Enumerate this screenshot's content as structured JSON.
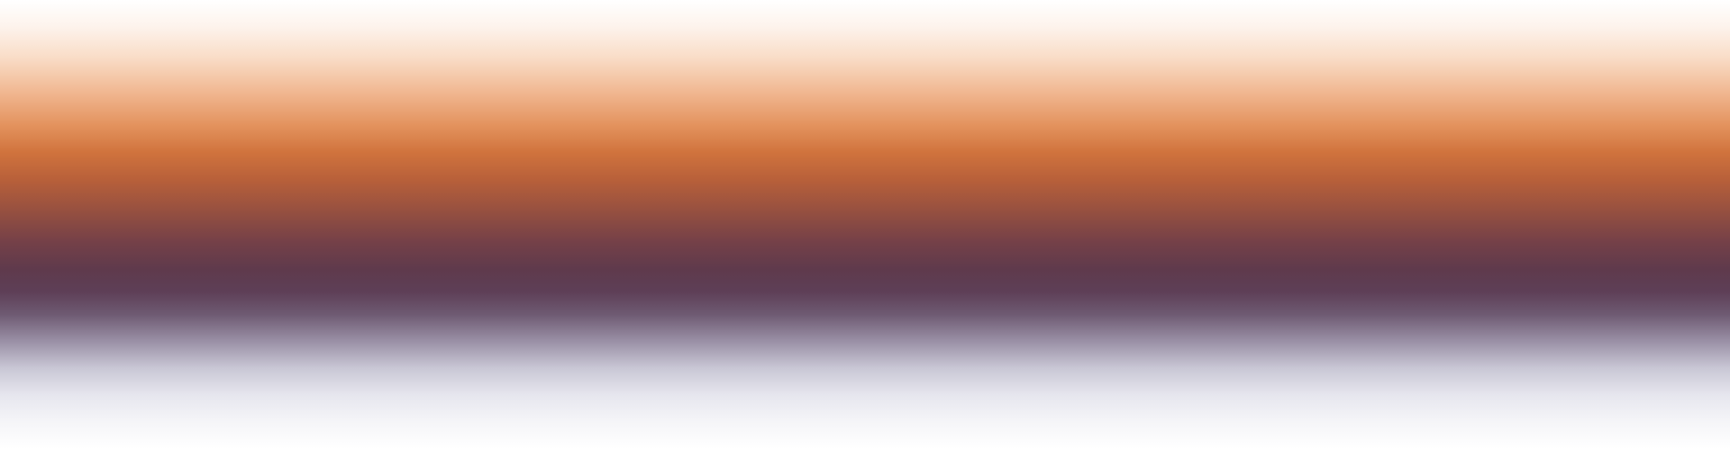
{
  "scene": {
    "description_colors": {
      "top": "#ffffff",
      "light_peach": "#f9dcc6",
      "orange": "#d0733d",
      "rust": "#965040",
      "plum": "#5f3a4c",
      "lavender_gray": "#c9c7d5",
      "bottom": "#ffffff"
    }
  }
}
